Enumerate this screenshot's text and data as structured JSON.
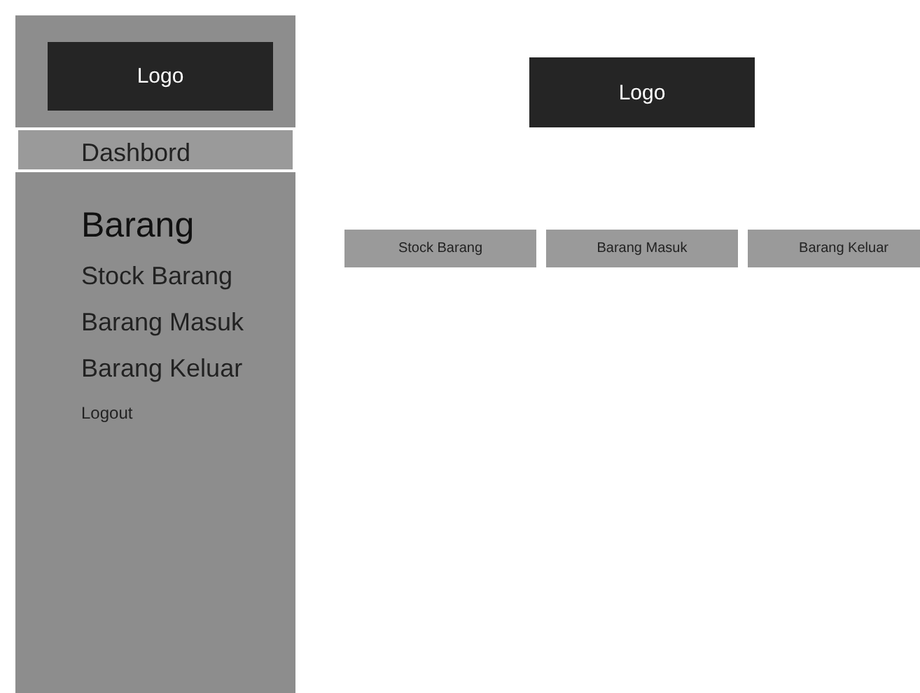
{
  "sidebar": {
    "logo": "Logo",
    "items": [
      {
        "label": "Dashbord",
        "kind": "link",
        "selected": true
      },
      {
        "label": "Barang",
        "kind": "heading",
        "selected": false
      },
      {
        "label": "Stock Barang",
        "kind": "link",
        "selected": false
      },
      {
        "label": "Barang Masuk",
        "kind": "link",
        "selected": false
      },
      {
        "label": "Barang Keluar",
        "kind": "link",
        "selected": false
      },
      {
        "label": "Logout",
        "kind": "small",
        "selected": false
      }
    ]
  },
  "main": {
    "logo": "Logo",
    "buttons": [
      "Stock Barang",
      "Barang Masuk",
      "Barang Keluar"
    ]
  }
}
